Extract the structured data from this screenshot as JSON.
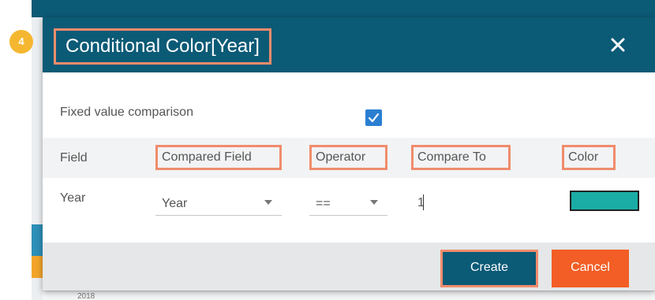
{
  "dialog": {
    "title": "Conditional Color[Year]",
    "step_badge": "4",
    "close_icon": "close-x-icon"
  },
  "fixed_value": {
    "label": "Fixed value comparison",
    "checked": true
  },
  "table": {
    "headers": {
      "field": "Field",
      "compared_field": "Compared Field",
      "operator": "Operator",
      "compare_to": "Compare To",
      "color": "Color"
    },
    "rows": [
      {
        "field": "Year",
        "compared_field": "Year",
        "operator": "==",
        "compare_to": "1",
        "color": "#1aada5"
      }
    ]
  },
  "buttons": {
    "create": "Create",
    "cancel": "Cancel"
  },
  "background": {
    "year_label": "2018"
  },
  "colors": {
    "header": "#0b5a76",
    "highlight": "#f08c6c",
    "badge": "#f5b730",
    "cancel": "#f25e25",
    "checkbox": "#2a7fd1"
  }
}
